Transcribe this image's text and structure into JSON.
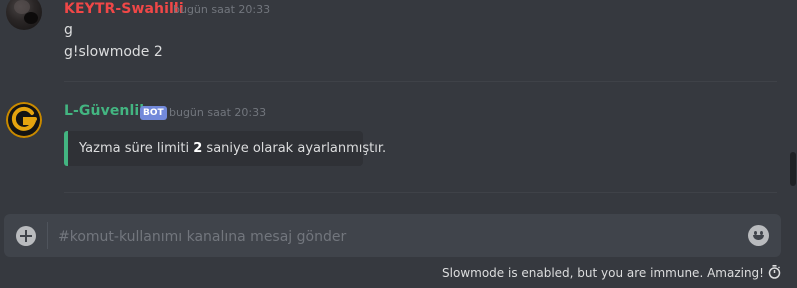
{
  "messages": [
    {
      "author": "KEYTR-Swahilli",
      "timestamp": "bugün saat 20:33",
      "lines": [
        "g",
        "g!slowmode 2"
      ]
    },
    {
      "author": "L-Güvenlik",
      "bot_tag": "BOT",
      "timestamp": "bugün saat 20:33",
      "embed": {
        "text_before": "Yazma süre limiti ",
        "value": "2",
        "text_after": " saniye olarak ayarlanmıştır."
      }
    }
  ],
  "composer": {
    "placeholder": "#komut-kullanımı kanalına mesaj gönder",
    "value": ""
  },
  "status": {
    "slowmode_text": "Slowmode is enabled, but you are immune. Amazing!"
  },
  "colors": {
    "background": "#36393f",
    "user_red": "#f04747",
    "user_green": "#43b581",
    "bot_tag": "#7289da",
    "embed_bg": "#2f3136",
    "input_bg": "#40444b"
  },
  "icons": {
    "attach": "plus-circle-icon",
    "emoji": "smiley-face-icon",
    "slowmode": "stopwatch-icon"
  }
}
